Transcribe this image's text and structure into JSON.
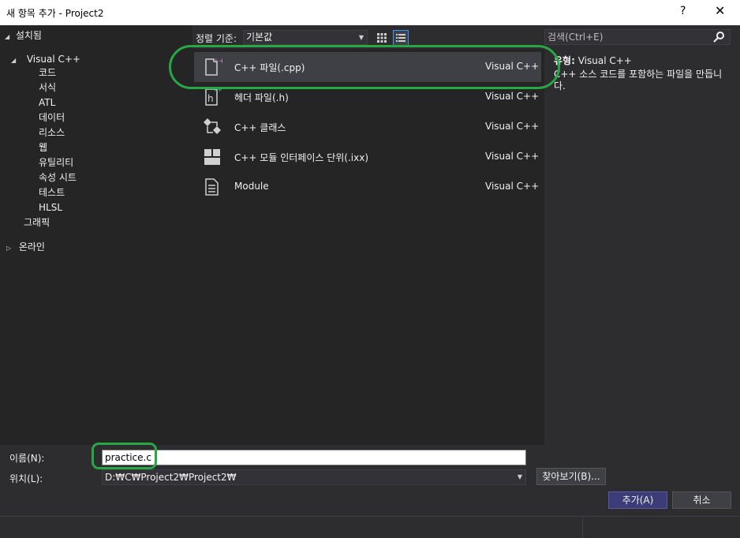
{
  "window": {
    "title": "새 항목 추가 - Project2",
    "help_label": "?",
    "close_label": "✕"
  },
  "tree": {
    "installed_label": "설치됨",
    "visual_cpp_label": "Visual C++",
    "children": [
      "코드",
      "서식",
      "ATL",
      "데이터",
      "리소스",
      "웹",
      "유틸리티",
      "속성 시트",
      "테스트",
      "HLSL"
    ],
    "graphics_label": "그래픽",
    "online_label": "온라인"
  },
  "sort": {
    "label": "정렬 기준:",
    "value": "기본값"
  },
  "templates": [
    {
      "name": "C++ 파일(.cpp)",
      "lang": "Visual C++",
      "icon": "cpp-file-icon",
      "selected": true
    },
    {
      "name": "헤더 파일(.h)",
      "lang": "Visual C++",
      "icon": "header-file-icon",
      "selected": false
    },
    {
      "name": "C++ 클래스",
      "lang": "Visual C++",
      "icon": "class-icon",
      "selected": false
    },
    {
      "name": "C++ 모듈 인터페이스 단위(.ixx)",
      "lang": "Visual C++",
      "icon": "module-interface-icon",
      "selected": false
    },
    {
      "name": "Module",
      "lang": "Visual C++",
      "icon": "module-file-icon",
      "selected": false
    }
  ],
  "search": {
    "placeholder": "검색(Ctrl+E)"
  },
  "description": {
    "type_label": "유형:",
    "type_value": "Visual C++",
    "text": "C++ 소스 코드를 포함하는 파일을 만듭니다."
  },
  "form": {
    "name_label": "이름(N):",
    "name_value": "practice.c",
    "location_label": "위치(L):",
    "location_value": "D:₩C₩Project2₩Project2₩",
    "browse_label": "찾아보기(B)...",
    "add_label": "추가(A)",
    "cancel_label": "취소"
  },
  "colors": {
    "accent": "#3399ff",
    "highlight_annotation": "#28a745",
    "primary_button": "#3c3c78"
  }
}
